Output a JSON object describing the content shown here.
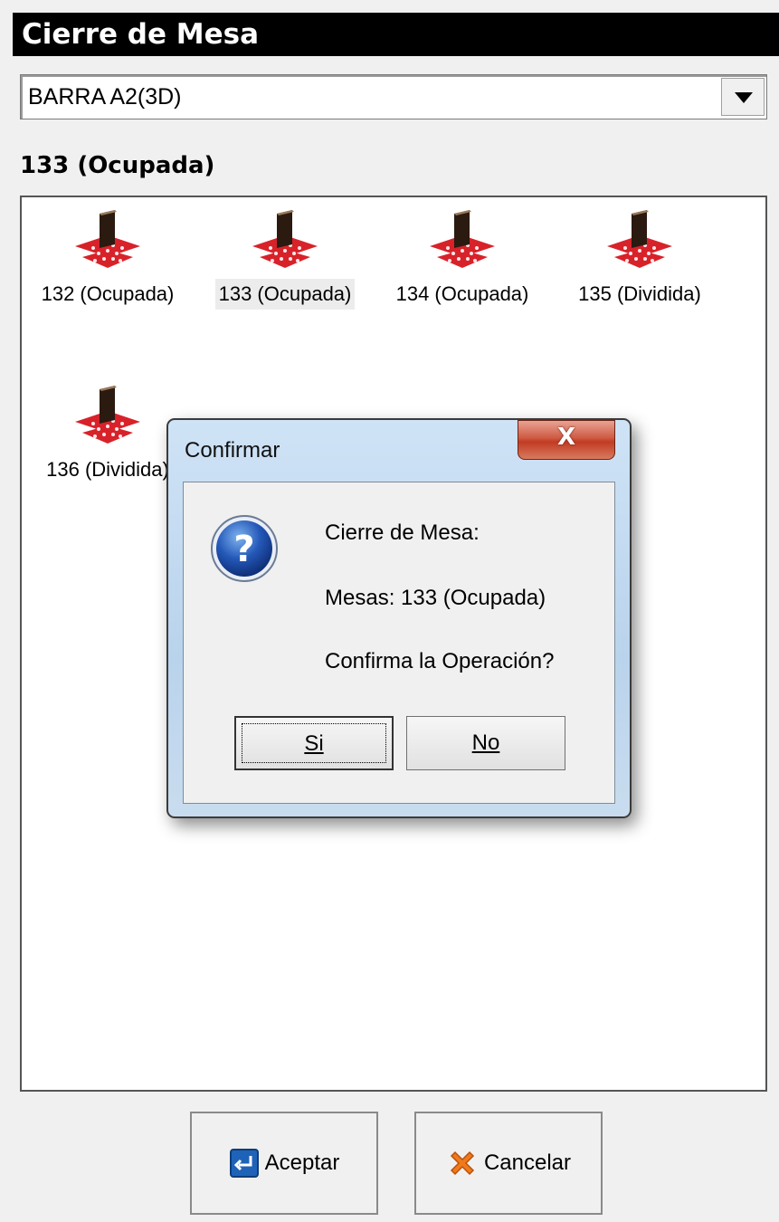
{
  "window": {
    "title": "Cierre de Mesa"
  },
  "area_select": {
    "value": "BARRA A2(3D)"
  },
  "selected_table_title": "133 (Ocupada)",
  "tables": [
    {
      "label": "132 (Ocupada)",
      "selected": false
    },
    {
      "label": "133 (Ocupada)",
      "selected": true
    },
    {
      "label": "134 (Ocupada)",
      "selected": false
    },
    {
      "label": "135 (Dividida)",
      "selected": false
    },
    {
      "label": "136 (Dividida)",
      "selected": false
    }
  ],
  "footer": {
    "accept_label": "Aceptar",
    "cancel_label": "Cancelar"
  },
  "dialog": {
    "title": "Confirmar",
    "line1": "Cierre de Mesa:",
    "line2": "Mesas: 133 (Ocupada)",
    "line3": "Confirma la Operación?",
    "yes_label": "Si",
    "no_label": "No",
    "close_glyph": "X"
  },
  "colors": {
    "title_bg": "#000000",
    "accept_icon": "#1f63b8",
    "cancel_icon": "#f07a1a",
    "table_cloth": "#d8222a"
  }
}
